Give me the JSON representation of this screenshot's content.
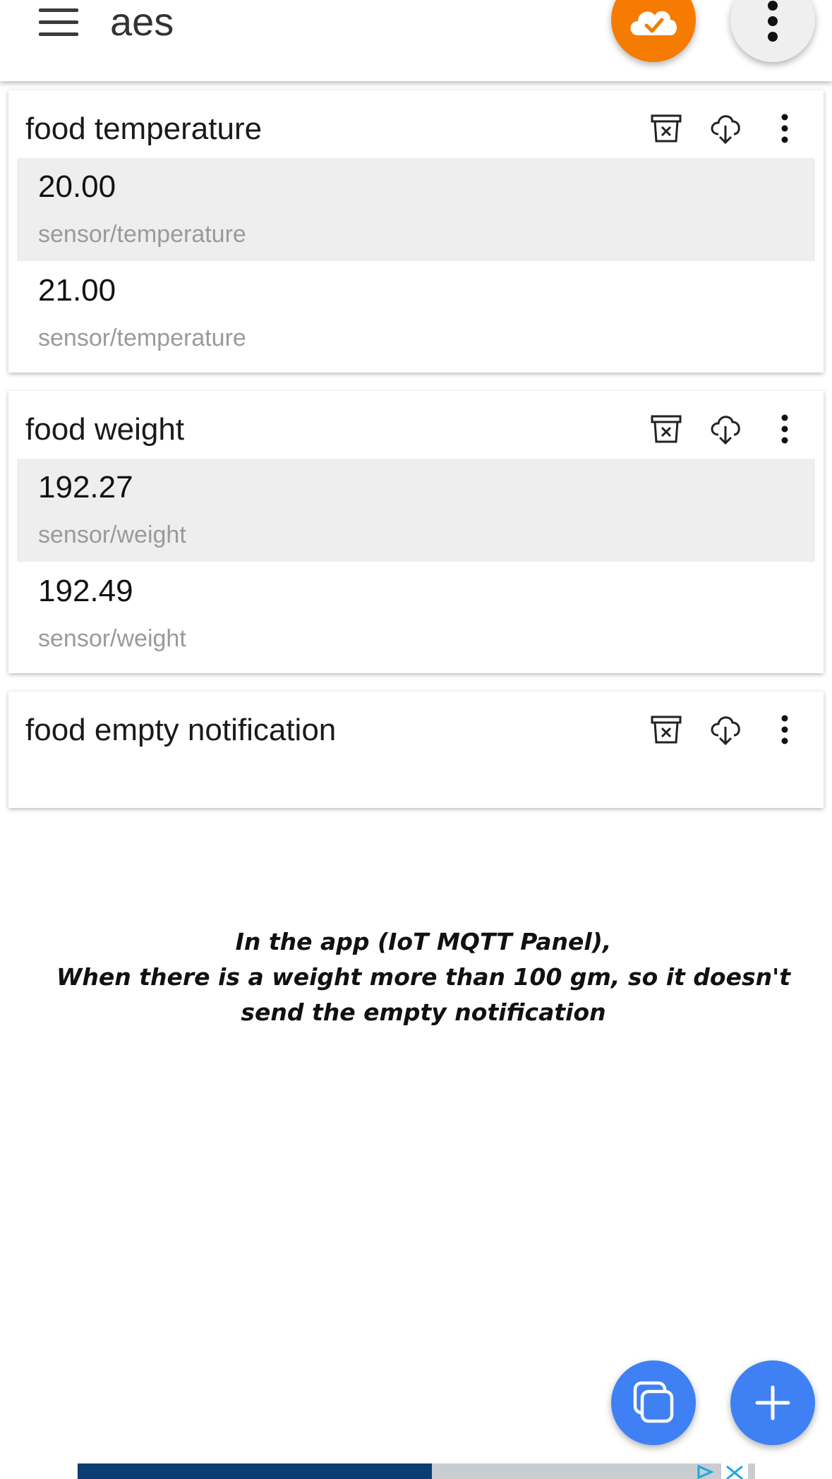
{
  "app": {
    "title": "aes",
    "accent_color": "#f57c00",
    "fab_color": "#3f80f4",
    "icons": {
      "menu": "hamburger-menu-icon",
      "connection": "cloud-check-icon",
      "overflow": "more-vertical-icon",
      "delete": "archive-delete-icon",
      "download": "cloud-download-icon",
      "duplicate": "copy-icon",
      "add": "plus-icon"
    }
  },
  "panels": [
    {
      "title": "food temperature",
      "messages": [
        {
          "value": "20.00",
          "topic": "sensor/temperature",
          "highlighted": true
        },
        {
          "value": "21.00",
          "topic": "sensor/temperature",
          "highlighted": false
        }
      ]
    },
    {
      "title": "food weight",
      "messages": [
        {
          "value": "192.27",
          "topic": "sensor/weight",
          "highlighted": true
        },
        {
          "value": "192.49",
          "topic": "sensor/weight",
          "highlighted": false
        }
      ]
    },
    {
      "title": "food empty notification",
      "messages": []
    }
  ],
  "note": {
    "line1": "In the app (IoT MQTT Panel),",
    "line2": "When there is a weight more than 100 gm, so it doesn't",
    "line3": "send the empty notification"
  }
}
